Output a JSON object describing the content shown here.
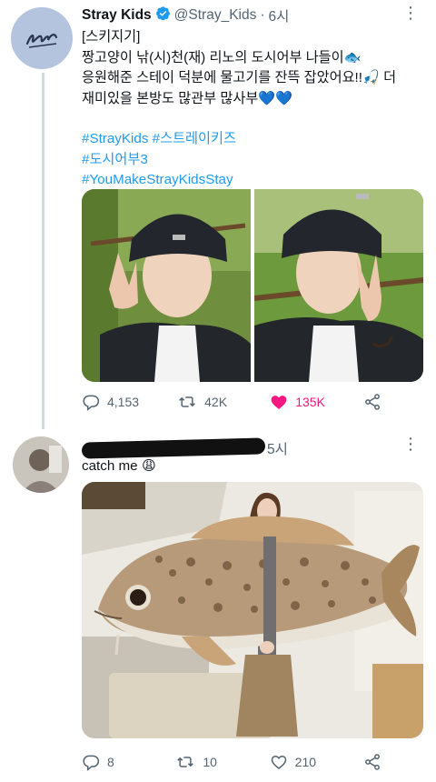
{
  "tweet1": {
    "display_name": "Stray Kids",
    "handle": "@Stray_Kids",
    "separator": "·",
    "time": "6시",
    "avatar_icon": "skz-logo-icon",
    "lines": [
      "[스키지기]",
      "짱고양이 낚(시)천(재) 리노의 도시어부 나들이🐟",
      "응원해준 스테이 덕분에 물고기를 잔뜩 잡았어요!!🎣 더",
      "재미있을 본방도 많관부 많사부💙💙"
    ],
    "hashtags": [
      "#StrayKids #스트레이키즈",
      "#도시어부3",
      "#YouMakeStrayKidsStay"
    ],
    "stats": {
      "replies": "4,153",
      "retweets": "42K",
      "likes": "135K"
    }
  },
  "tweet2": {
    "time": "5시",
    "text": "catch me 😩",
    "stats": {
      "replies": "8",
      "retweets": "10",
      "likes": "210"
    }
  },
  "colors": {
    "accent": "#1d9bf0",
    "like": "#f91880",
    "muted": "#536471"
  }
}
